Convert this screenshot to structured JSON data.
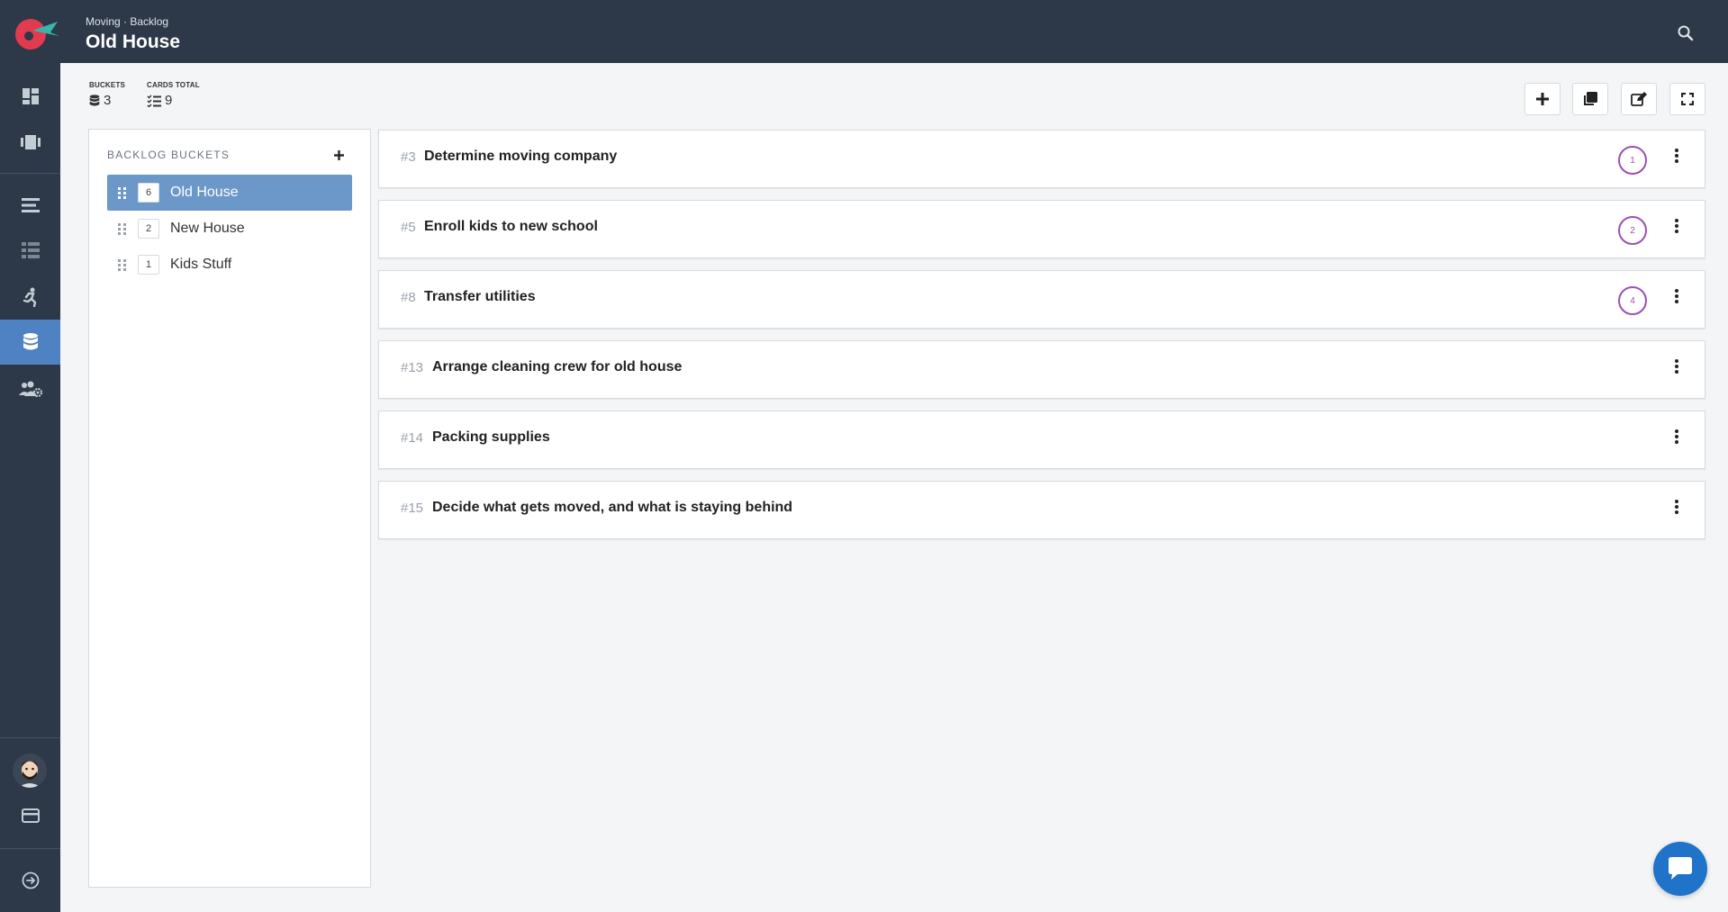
{
  "header": {
    "breadcrumb": "Moving · Backlog",
    "title": "Old House"
  },
  "stats": {
    "buckets_label": "BUCKETS",
    "buckets_value": "3",
    "cards_label": "CARDS TOTAL",
    "cards_value": "9"
  },
  "buckets_panel": {
    "title": "BACKLOG BUCKETS",
    "items": [
      {
        "count": "6",
        "name": "Old House",
        "active": true
      },
      {
        "count": "2",
        "name": "New House",
        "active": false
      },
      {
        "count": "1",
        "name": "Kids Stuff",
        "active": false
      }
    ]
  },
  "cards": [
    {
      "number": "#3",
      "title": "Determine moving company",
      "estimate": "1"
    },
    {
      "number": "#5",
      "title": "Enroll kids to new school",
      "estimate": "2"
    },
    {
      "number": "#8",
      "title": "Transfer utilities",
      "estimate": "4"
    },
    {
      "number": "#13",
      "title": "Arrange cleaning crew for old house",
      "estimate": ""
    },
    {
      "number": "#14",
      "title": "Packing supplies",
      "estimate": ""
    },
    {
      "number": "#15",
      "title": "Decide what gets moved, and what is staying behind",
      "estimate": ""
    }
  ],
  "colors": {
    "sidebar": "#2d3848",
    "active_nav": "#4f82c2",
    "active_bucket": "#6b97c9",
    "estimate": "#9b4fb5",
    "chat": "#1f73c9"
  },
  "icons": [
    "dashboard-icon",
    "board-icon",
    "list-icon",
    "table-icon",
    "sprint-icon",
    "backlog-database-icon",
    "team-settings-icon",
    "billing-card-icon",
    "logout-icon",
    "search-icon",
    "plus-icon",
    "copy-icon",
    "edit-icon",
    "fullscreen-icon",
    "chat-icon"
  ]
}
